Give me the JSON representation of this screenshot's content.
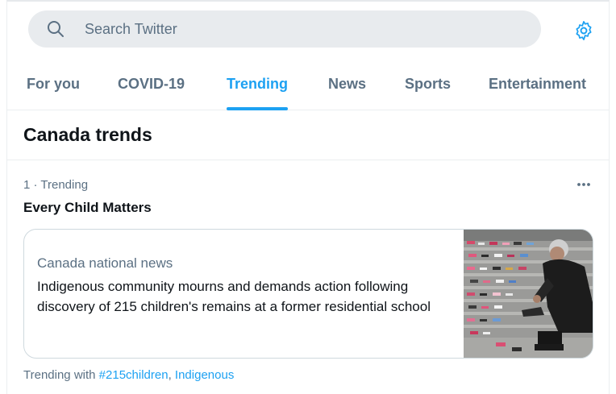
{
  "search": {
    "placeholder": "Search Twitter"
  },
  "tabs": [
    {
      "label": "For you",
      "active": false
    },
    {
      "label": "COVID-19",
      "active": false
    },
    {
      "label": "Trending",
      "active": true
    },
    {
      "label": "News",
      "active": false
    },
    {
      "label": "Sports",
      "active": false
    },
    {
      "label": "Entertainment",
      "active": false
    }
  ],
  "section": {
    "title": "Canada trends"
  },
  "trend": {
    "meta": "1 · Trending",
    "name": "Every Child Matters",
    "news": {
      "source": "Canada national news",
      "headline": "Indigenous community mourns and demands action following discovery of 215 children's remains at a former residential school"
    },
    "trending_with_label": "Trending with",
    "hashtag": "#215children",
    "separator": ",",
    "related": "Indigenous"
  },
  "colors": {
    "accent": "#1da1f2",
    "muted": "#5b7083",
    "text": "#0f1419",
    "search_bg": "#e8ebee"
  },
  "icons": {
    "search": "search-icon",
    "settings": "gear-icon",
    "more": "more-horizontal-icon"
  }
}
